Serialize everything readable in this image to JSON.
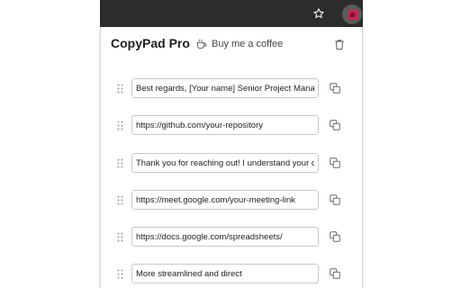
{
  "browser": {
    "bookmark_icon": "star-icon",
    "extension_icon": "copypad-extension-icon"
  },
  "header": {
    "title": "CopyPad Pro",
    "coffee_label": "Buy me a coffee",
    "coffee_icon": "coffee-cup-icon",
    "clear_icon": "trash-icon"
  },
  "clips": [
    {
      "value": "Best regards, [Your name] Senior Project Manag"
    },
    {
      "value": "https://github.com/your-repository"
    },
    {
      "value": "Thank you for reaching out! I understand your cc"
    },
    {
      "value": "https://meet.google.com/your-meeting-link"
    },
    {
      "value": "https://docs.google.com/spreadsheets/"
    },
    {
      "value": "More streamlined and direct"
    }
  ],
  "colors": {
    "toolbar": "#2c2c2c",
    "extension_badge": "#c8264b",
    "field_border": "#c9c9c9"
  }
}
